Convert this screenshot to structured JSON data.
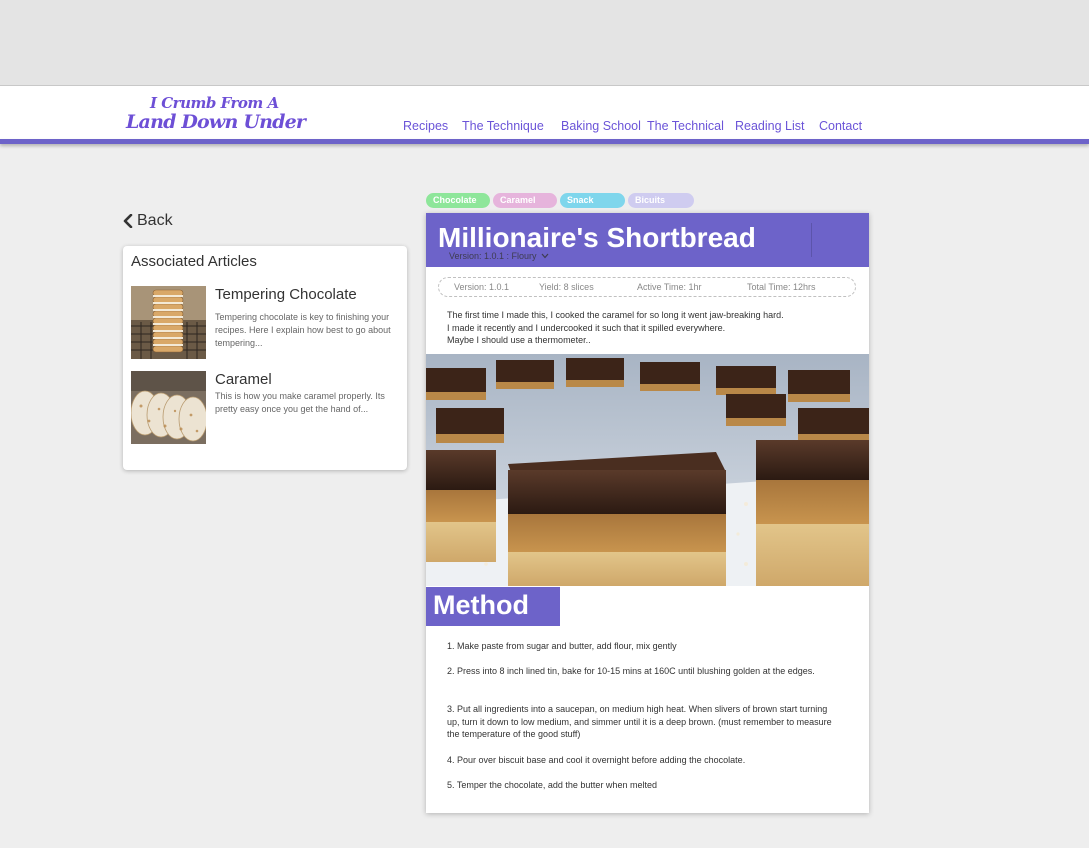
{
  "brand": {
    "line1": "I Crumb From A",
    "line2": "Land Down Under",
    "color": "#6d4fd6"
  },
  "nav": {
    "items": [
      {
        "label": "Recipes"
      },
      {
        "label": "The Technique"
      },
      {
        "label": "Baking School"
      },
      {
        "label": "The Technical"
      },
      {
        "label": "Reading List"
      },
      {
        "label": "Contact"
      }
    ],
    "accent": "#6d63c9"
  },
  "back": {
    "icon": "chevron-left-icon",
    "label": "Back"
  },
  "associated": {
    "title": "Associated Articles",
    "articles": [
      {
        "title": "Tempering Chocolate",
        "description": "Tempering chocolate is key to finishing your recipes. Here I explain how best to go about tempering...",
        "thumbnail": "stacked-cookies-image"
      },
      {
        "title": "Caramel",
        "description": "This is how you make caramel properly. Its pretty easy once you get the hand of...",
        "thumbnail": "tortillas-image"
      }
    ]
  },
  "tags": [
    {
      "label": "Chocolate",
      "color": "#8ee69a"
    },
    {
      "label": "Caramel",
      "color": "#e6b4dc"
    },
    {
      "label": "Snack",
      "color": "#7fd6ec"
    },
    {
      "label": "Bicuits",
      "color": "#cfccf0"
    }
  ],
  "recipe": {
    "title": "Millionaire's Shortbread",
    "version_select": "Version: 1.0.1 : Floury",
    "meta": {
      "version": "Version: 1.0.1",
      "yield": "Yield: 8 slices",
      "active_time": "Active Time: 1hr",
      "total_time": "Total Time: 12hrs"
    },
    "intro": [
      "The first time I made this, I cooked the caramel for so long it went jaw-breaking hard.",
      "I made it recently and I undercooked it such that it spilled everywhere.",
      "Maybe I should use a thermometer.."
    ],
    "hero_image": "millionaires-shortbread-photo",
    "method_title": "Method",
    "steps": [
      "1. Make paste from sugar and butter, add flour, mix gently",
      "2. Press into 8 inch lined tin, bake for 10-15 mins at 160C until blushing golden at the edges.",
      "3. Put all ingredients into a saucepan, on medium high heat. When slivers of brown start turning up, turn it down to low medium, and simmer until it is a deep brown. (must remember to measure the temperature of the good stuff)",
      "4. Pour over biscuit base and cool it overnight before adding the chocolate.",
      "5. Temper the chocolate, add the butter when melted"
    ]
  }
}
